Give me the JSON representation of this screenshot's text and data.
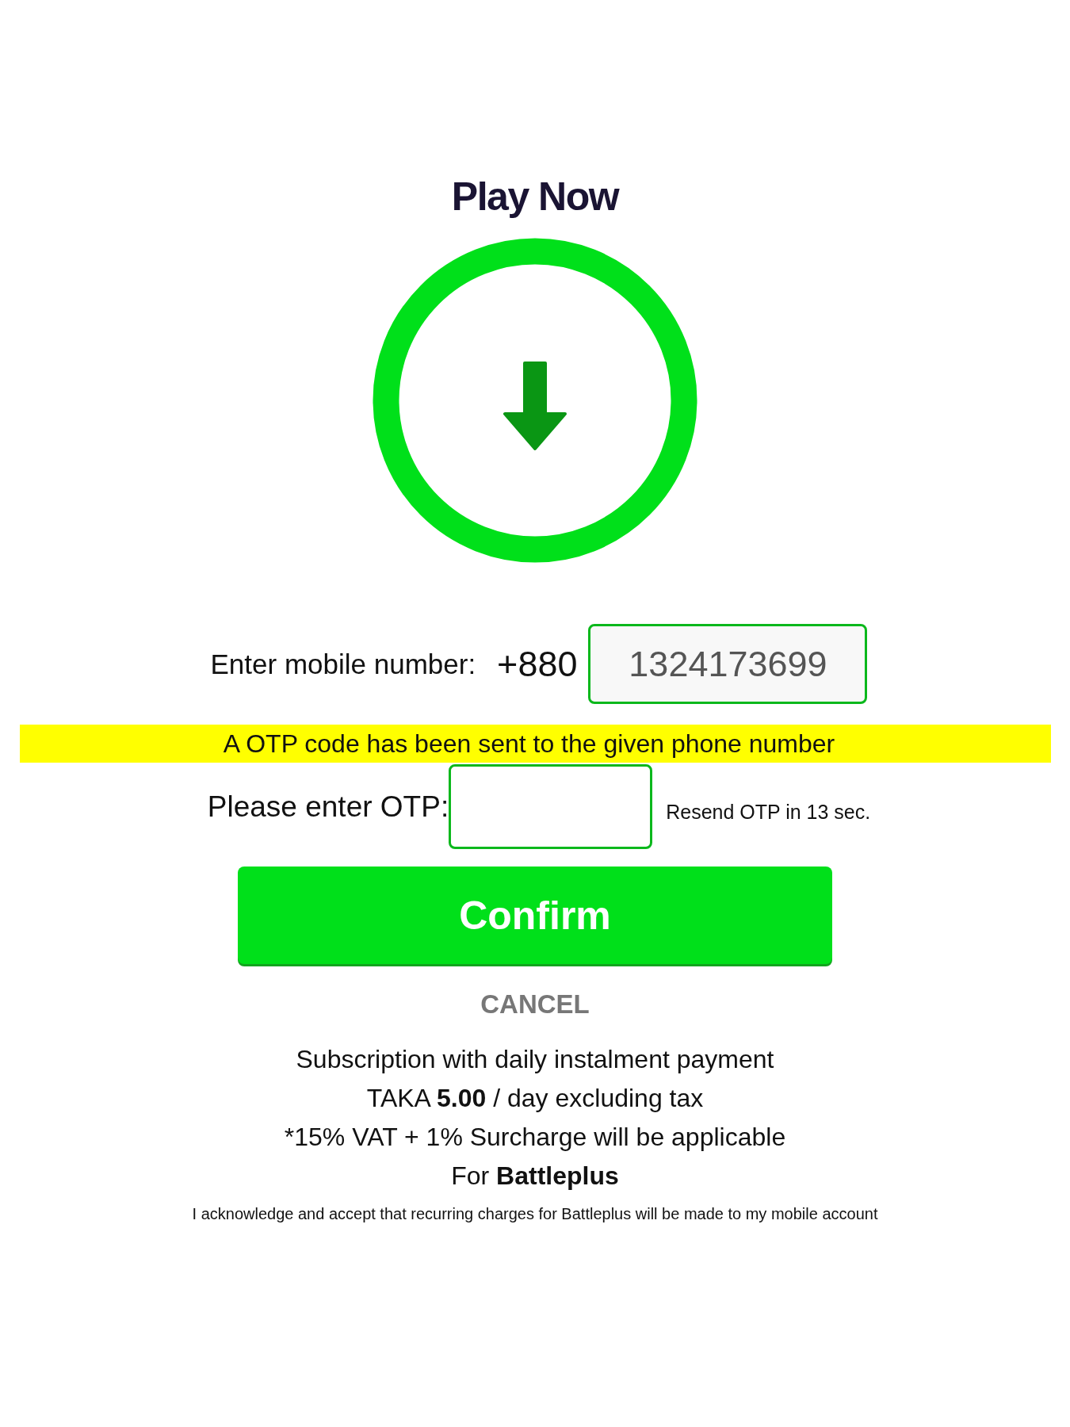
{
  "title": "Play Now",
  "mobile": {
    "label": "Enter mobile number:",
    "prefix": "+880",
    "value": "1324173699"
  },
  "notice": "A OTP code has been sent to the given phone number",
  "otp": {
    "label": "Please enter OTP:",
    "resend": "Resend OTP in 13 sec."
  },
  "confirm_button": "Confirm",
  "cancel_link": "CANCEL",
  "terms": [
    "Subscription with daily instalment payment",
    "TAKA **5.00** / day excluding tax",
    "*15% VAT + 1% Surcharge will be applicable",
    "For **Battleplus**"
  ],
  "acknowledgement": "I acknowledge and accept that recurring charges for Battleplus will be made to my mobile account"
}
